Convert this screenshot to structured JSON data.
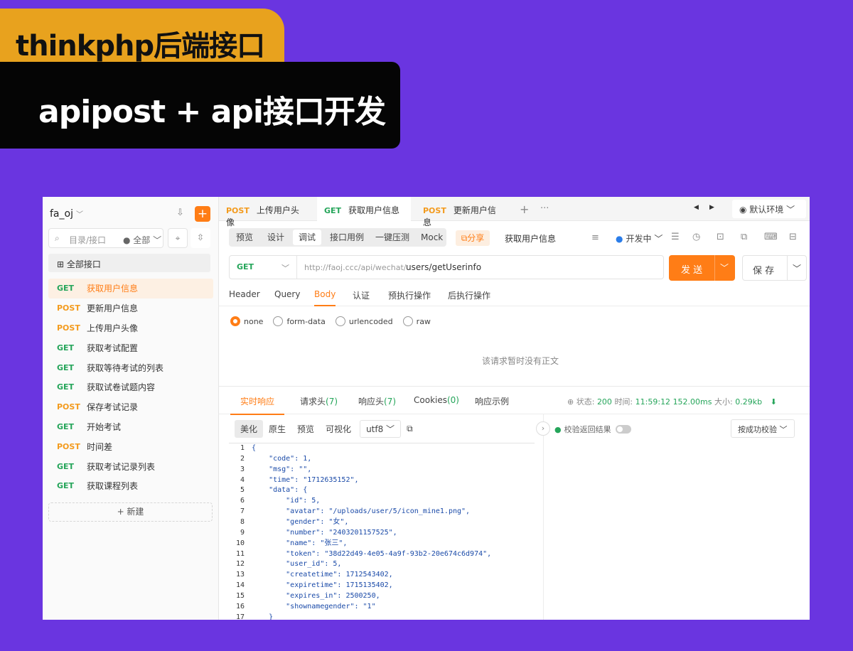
{
  "banner": {
    "title": "thinkphp后端接口",
    "subtitle": "apipost + api接口开发"
  },
  "sidebar": {
    "project": "fa_oj",
    "search_placeholder": "目录/接口",
    "filter": "全部",
    "all_api": "全部接口",
    "items": [
      {
        "method": "GET",
        "name": "获取用户信息"
      },
      {
        "method": "POST",
        "name": "更新用户信息"
      },
      {
        "method": "POST",
        "name": "上传用户头像"
      },
      {
        "method": "GET",
        "name": "获取考试配置"
      },
      {
        "method": "GET",
        "name": "获取等待考试的列表"
      },
      {
        "method": "GET",
        "name": "获取试卷试题内容"
      },
      {
        "method": "POST",
        "name": "保存考试记录"
      },
      {
        "method": "GET",
        "name": "开始考试"
      },
      {
        "method": "POST",
        "name": "时间差"
      },
      {
        "method": "GET",
        "name": "获取考试记录列表"
      },
      {
        "method": "GET",
        "name": "获取课程列表"
      }
    ],
    "new_label": "+ 新建"
  },
  "tabs": [
    {
      "method": "POST",
      "name": "上传用户头像"
    },
    {
      "method": "GET",
      "name": "获取用户信息"
    },
    {
      "method": "POST",
      "name": "更新用户信息"
    }
  ],
  "env": "默认环境",
  "toolbar": {
    "items": [
      "预览",
      "设计",
      "调试",
      "接口用例",
      "一键压测",
      "Mock"
    ],
    "share": "分享",
    "api_name": "获取用户信息",
    "status": "开发中"
  },
  "request": {
    "method": "GET",
    "base_url": "http://faoj.ccc/api/wechat/",
    "path": "users/getUserinfo",
    "send": "发 送",
    "save": "保 存"
  },
  "subtabs": [
    "Header",
    "Query",
    "Body",
    "认证",
    "预执行操作",
    "后执行操作"
  ],
  "body_types": [
    "none",
    "form-data",
    "urlencoded",
    "raw"
  ],
  "no_body": "该请求暂时没有正文",
  "response": {
    "tabs": [
      "实时响应",
      "请求头",
      "响应头",
      "Cookies",
      "响应示例"
    ],
    "counts": [
      "(7)",
      "(7)",
      "(0)"
    ],
    "status_label": "状态:",
    "status": "200",
    "time_label": "时间:",
    "time": "11:59:12",
    "duration": "152.00ms",
    "size_label": "大小:",
    "size": "0.29kb",
    "format_tabs": [
      "美化",
      "原生",
      "预览",
      "可视化"
    ],
    "encoding": "utf8",
    "verify_label": "校验返回结果",
    "success_check": "按成功校验"
  },
  "code_lines": [
    "{",
    "    \"code\": 1,",
    "    \"msg\": \"\",",
    "    \"time\": \"1712635152\",",
    "    \"data\": {",
    "        \"id\": 5,",
    "        \"avatar\": \"/uploads/user/5/icon_mine1.png\",",
    "        \"gender\": \"女\",",
    "        \"number\": \"2403201157525\",",
    "        \"name\": \"张三\",",
    "        \"token\": \"38d22d49-4e05-4a9f-93b2-20e674c6d974\",",
    "        \"user_id\": 5,",
    "        \"createtime\": 1712543402,",
    "        \"expiretime\": 1715135402,",
    "        \"expires_in\": 2500250,",
    "        \"shownamegender\": \"1\"",
    "    }"
  ]
}
